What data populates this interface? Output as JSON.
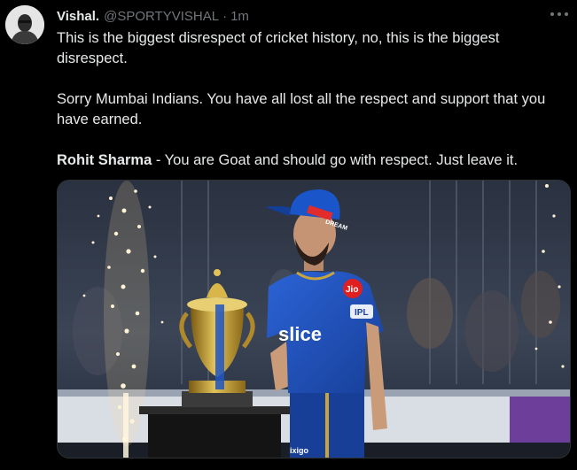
{
  "tweet": {
    "author_name": "Vishal.",
    "author_handle": "@SPORTYVISHAL",
    "separator": "·",
    "time": "1m",
    "more_icon": "more-horizontal-icon",
    "paragraphs": [
      "This is the biggest disrespect of cricket history, no, this is the biggest disrespect.",
      "Sorry Mumbai Indians. You have all lost all the respect and support that you have earned."
    ],
    "last_line": {
      "bold": "Rohit Sharma",
      "rest": " - You are Goat and should go with respect. Just leave it."
    }
  },
  "media": {
    "cap_logo": "DREAM",
    "jersey_sponsor": "slice",
    "chest_badge": "Jio",
    "sleeve_badge": "IPL",
    "pants_sponsor": "ixigo"
  },
  "colors": {
    "background": "#000000",
    "text": "#e7e9ea",
    "muted": "#71767b",
    "jersey_blue": "#1f4fb8",
    "trophy_gold": "#c9a23a"
  }
}
